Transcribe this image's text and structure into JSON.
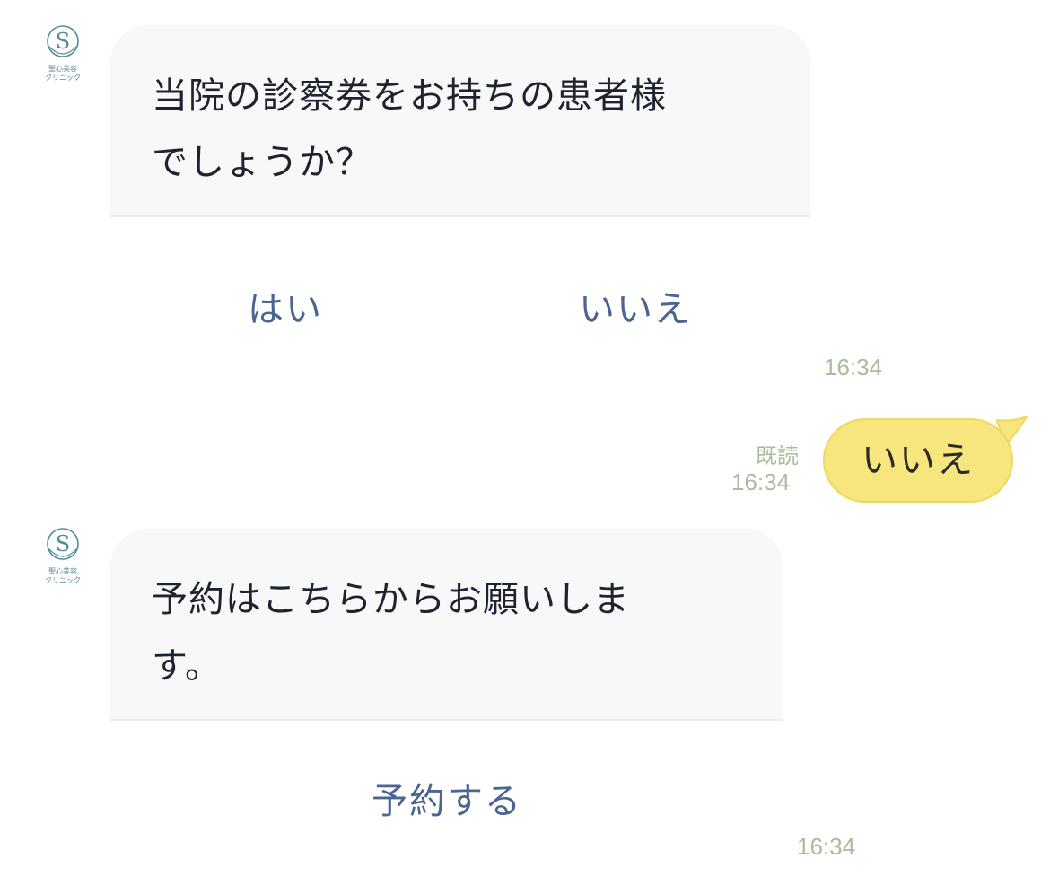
{
  "clinic": {
    "logo_letter": "S",
    "name_line1": "聖心美容",
    "name_line2": "クリニック"
  },
  "messages": {
    "question": {
      "line1": "当院の診察券をお持ちの患者様",
      "line2": "でしょうか？",
      "option_yes": "はい",
      "option_no": "いいえ",
      "time": "16:34"
    },
    "user_reply": {
      "text": "いいえ",
      "read_label": "既読",
      "time": "16:34"
    },
    "booking": {
      "line1": "予約はこちらからお願いしま",
      "line2": "す。",
      "action": "予約する",
      "time": "16:34"
    }
  },
  "colors": {
    "bubble_bg": "#f8f8f8",
    "user_bubble": "#f7e67d",
    "action_text": "#4b6591",
    "timestamp": "#a9bc9b"
  }
}
